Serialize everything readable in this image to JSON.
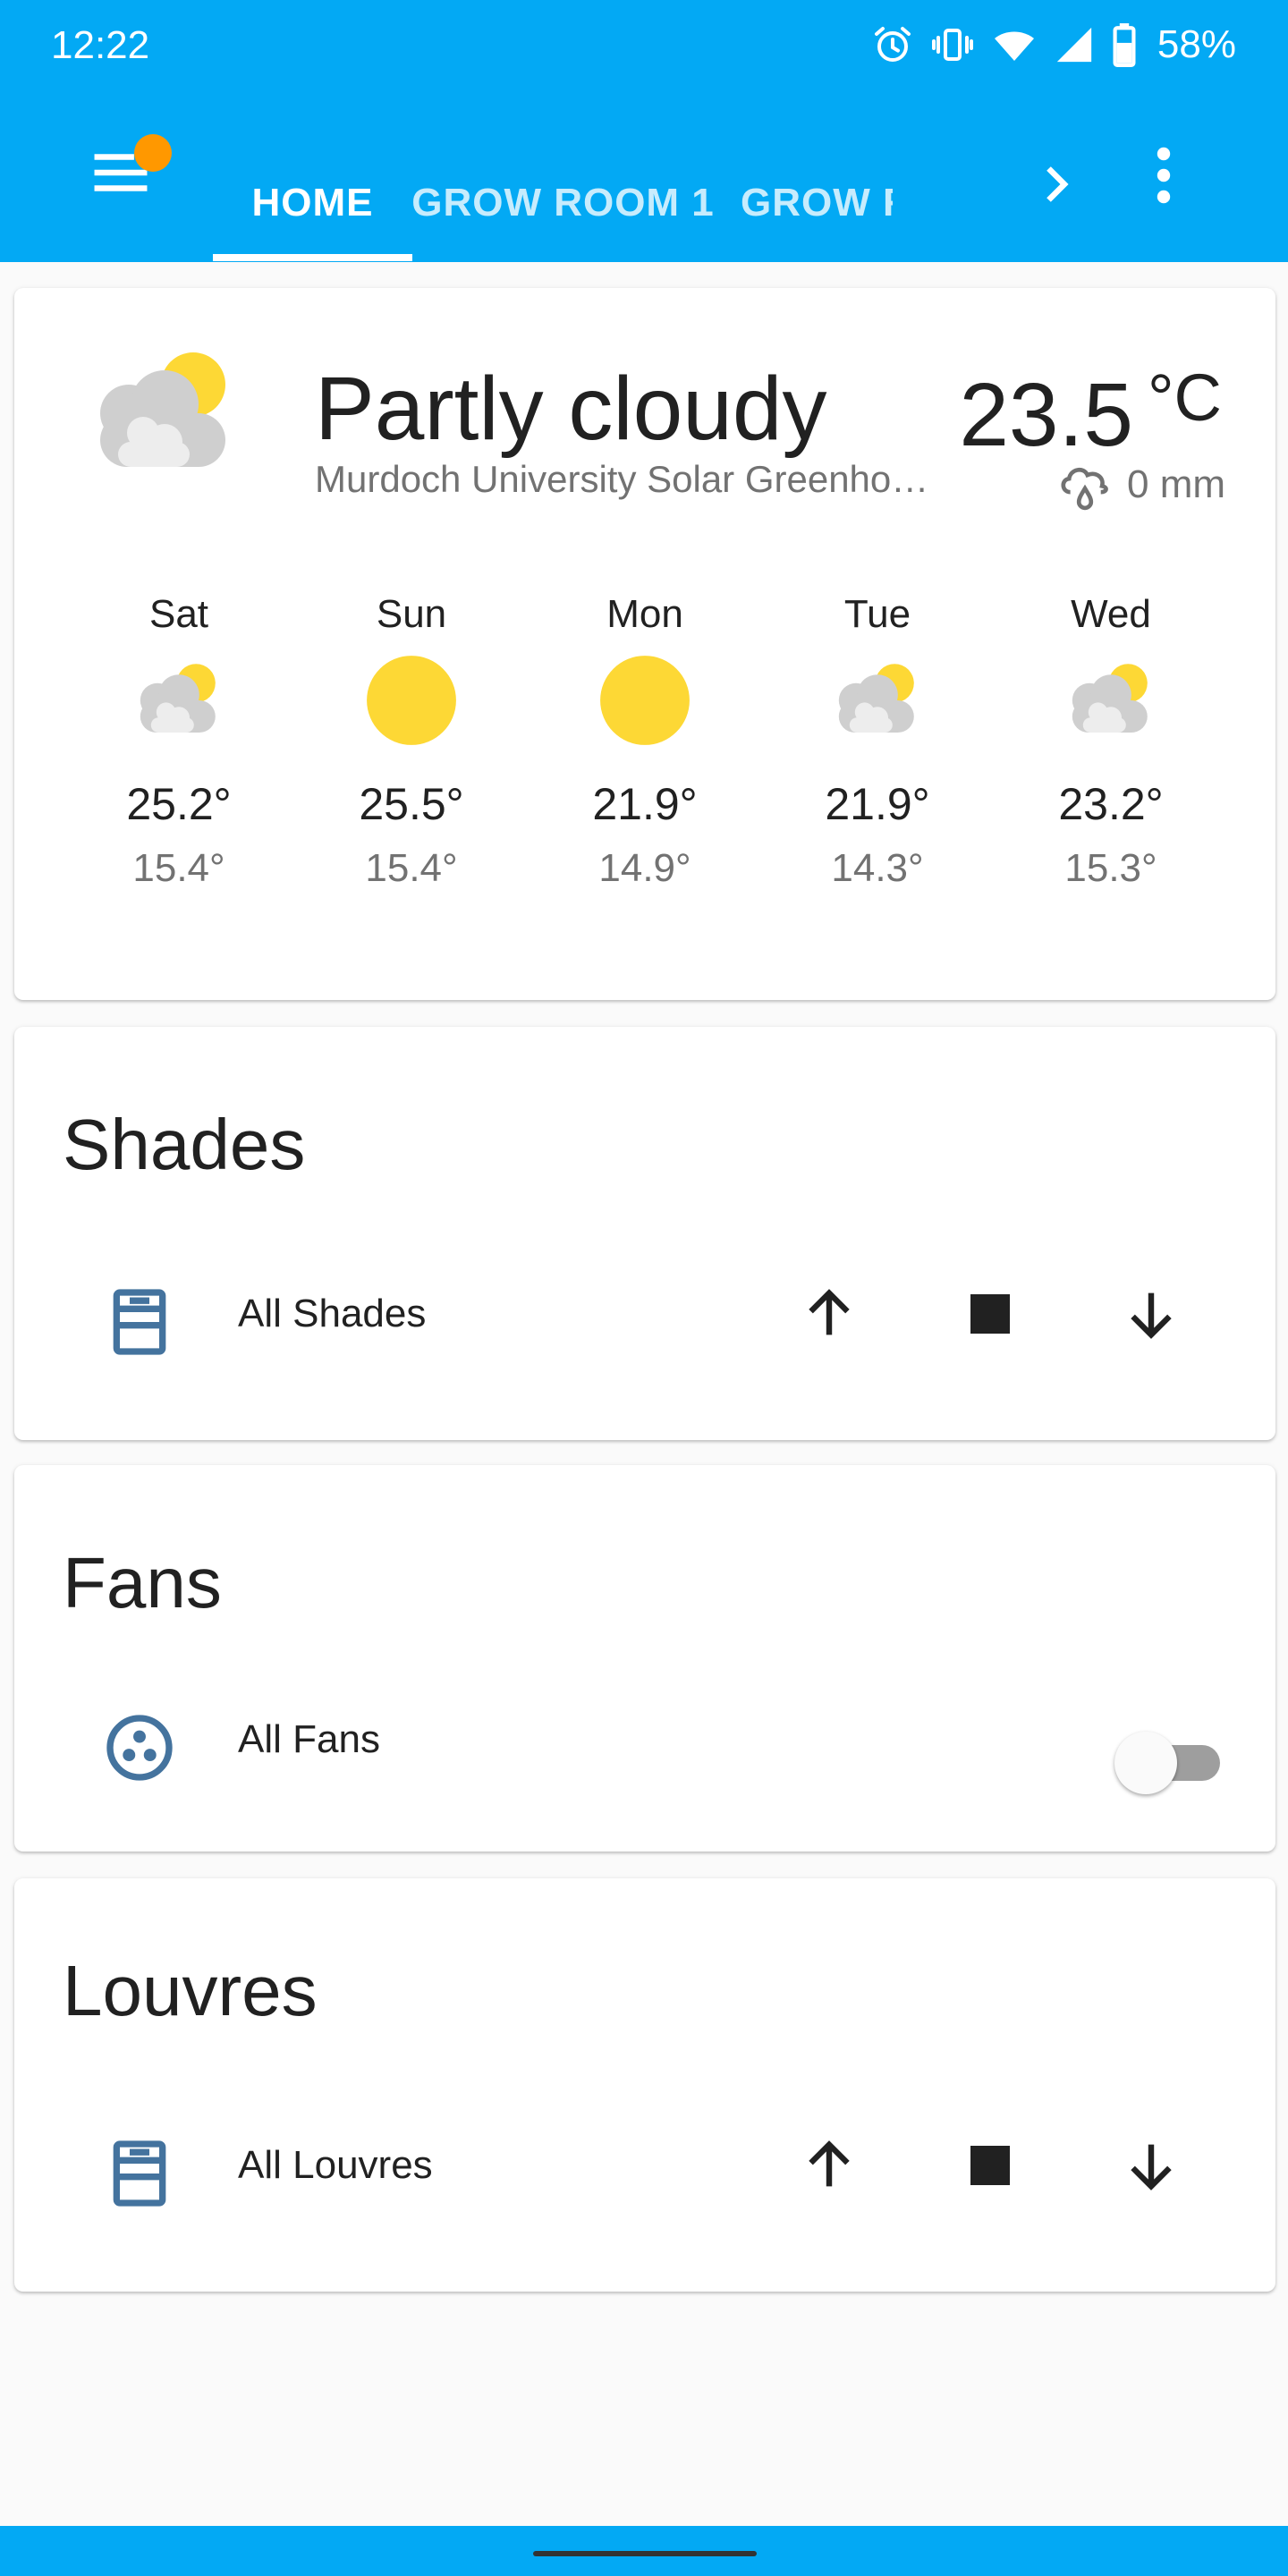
{
  "status_bar": {
    "time": "12:22",
    "battery": "58%",
    "icons": [
      "alarm-icon",
      "vibrate-icon",
      "wifi-icon",
      "signal-icon",
      "battery-icon"
    ]
  },
  "toolbar": {
    "menu_icon": "menu-icon",
    "tabs": [
      {
        "label": "HOME",
        "active": true
      },
      {
        "label": "GROW ROOM 1",
        "active": false
      },
      {
        "label": "GROW R",
        "active": false
      }
    ],
    "overflow_icon": "more-vert-icon"
  },
  "weather": {
    "condition": "Partly cloudy",
    "station": "Murdoch University Solar Greenhouse",
    "temperature": "23.5",
    "unit": "°C",
    "precipitation": "0 mm",
    "forecast": [
      {
        "day": "Sat",
        "icon": "partly-cloudy-icon",
        "high": "25.2°",
        "low": "15.4°"
      },
      {
        "day": "Sun",
        "icon": "sunny-icon",
        "high": "25.5°",
        "low": "15.4°"
      },
      {
        "day": "Mon",
        "icon": "sunny-icon",
        "high": "21.9°",
        "low": "14.9°"
      },
      {
        "day": "Tue",
        "icon": "partly-cloudy-icon",
        "high": "21.9°",
        "low": "14.3°"
      },
      {
        "day": "Wed",
        "icon": "partly-cloudy-icon",
        "high": "23.2°",
        "low": "15.3°"
      }
    ]
  },
  "shades": {
    "title": "Shades",
    "entity": "All Shades",
    "icon": "window-shade-icon"
  },
  "fans": {
    "title": "Fans",
    "entity": "All Fans",
    "icon": "fan-icon",
    "state": "off"
  },
  "louvres": {
    "title": "Louvres",
    "entity": "All Louvres",
    "icon": "window-shade-icon"
  },
  "colors": {
    "primary": "#03a9f4",
    "badge": "#ff9800",
    "sun": "#fdd835",
    "entity_icon": "#44739e"
  }
}
